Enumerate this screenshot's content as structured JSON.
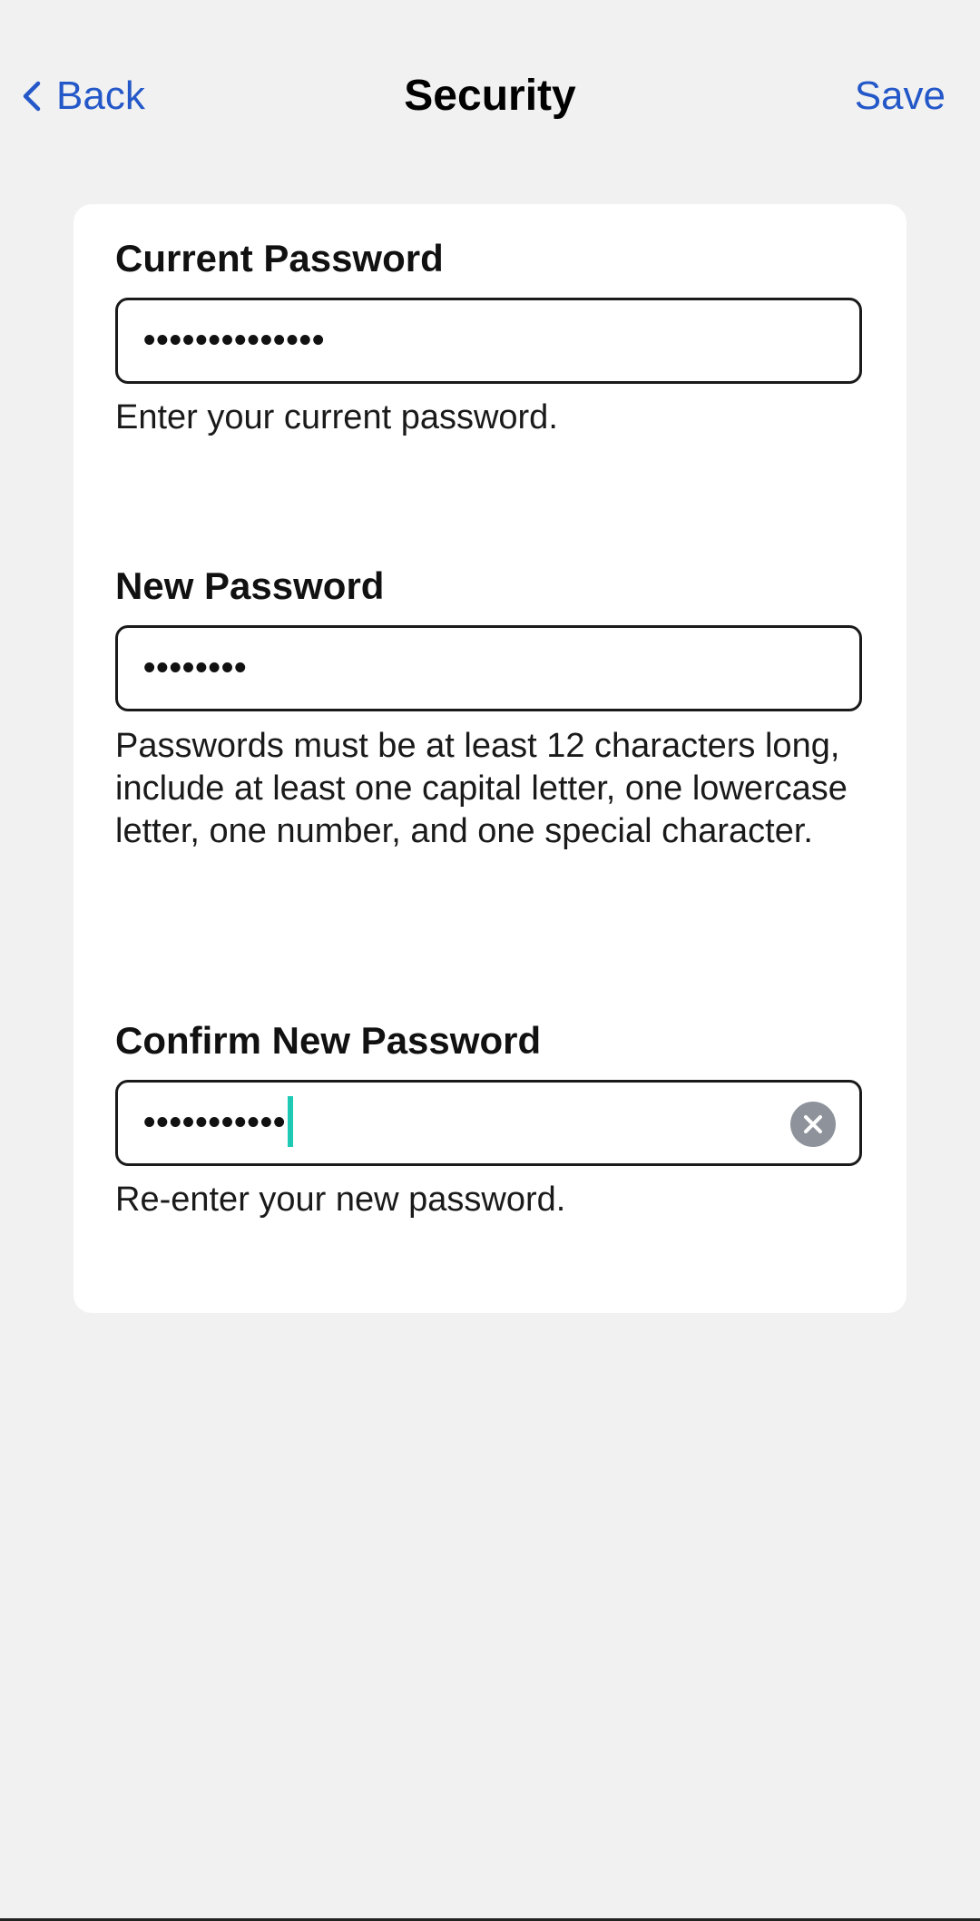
{
  "navbar": {
    "back_label": "Back",
    "title": "Security",
    "save_label": "Save"
  },
  "form": {
    "current_password": {
      "label": "Current Password",
      "value": "••••••••••••••",
      "helper": "Enter your current password."
    },
    "new_password": {
      "label": "New Password",
      "value": "••••••••",
      "helper": "Passwords must be at least 12 characters long, include at least one capital letter, one lowercase letter, one number, and one special character."
    },
    "confirm_password": {
      "label": "Confirm New Password",
      "value": "•••••••••••",
      "helper": "Re-enter your new password."
    }
  },
  "colors": {
    "accent": "#2458c9",
    "background": "#f1f1f1",
    "card": "#ffffff",
    "cursor": "#1fc9b4",
    "clear_button": "#8e939b"
  },
  "icons": {
    "back": "chevron-left-icon",
    "clear": "close-circle-icon"
  }
}
